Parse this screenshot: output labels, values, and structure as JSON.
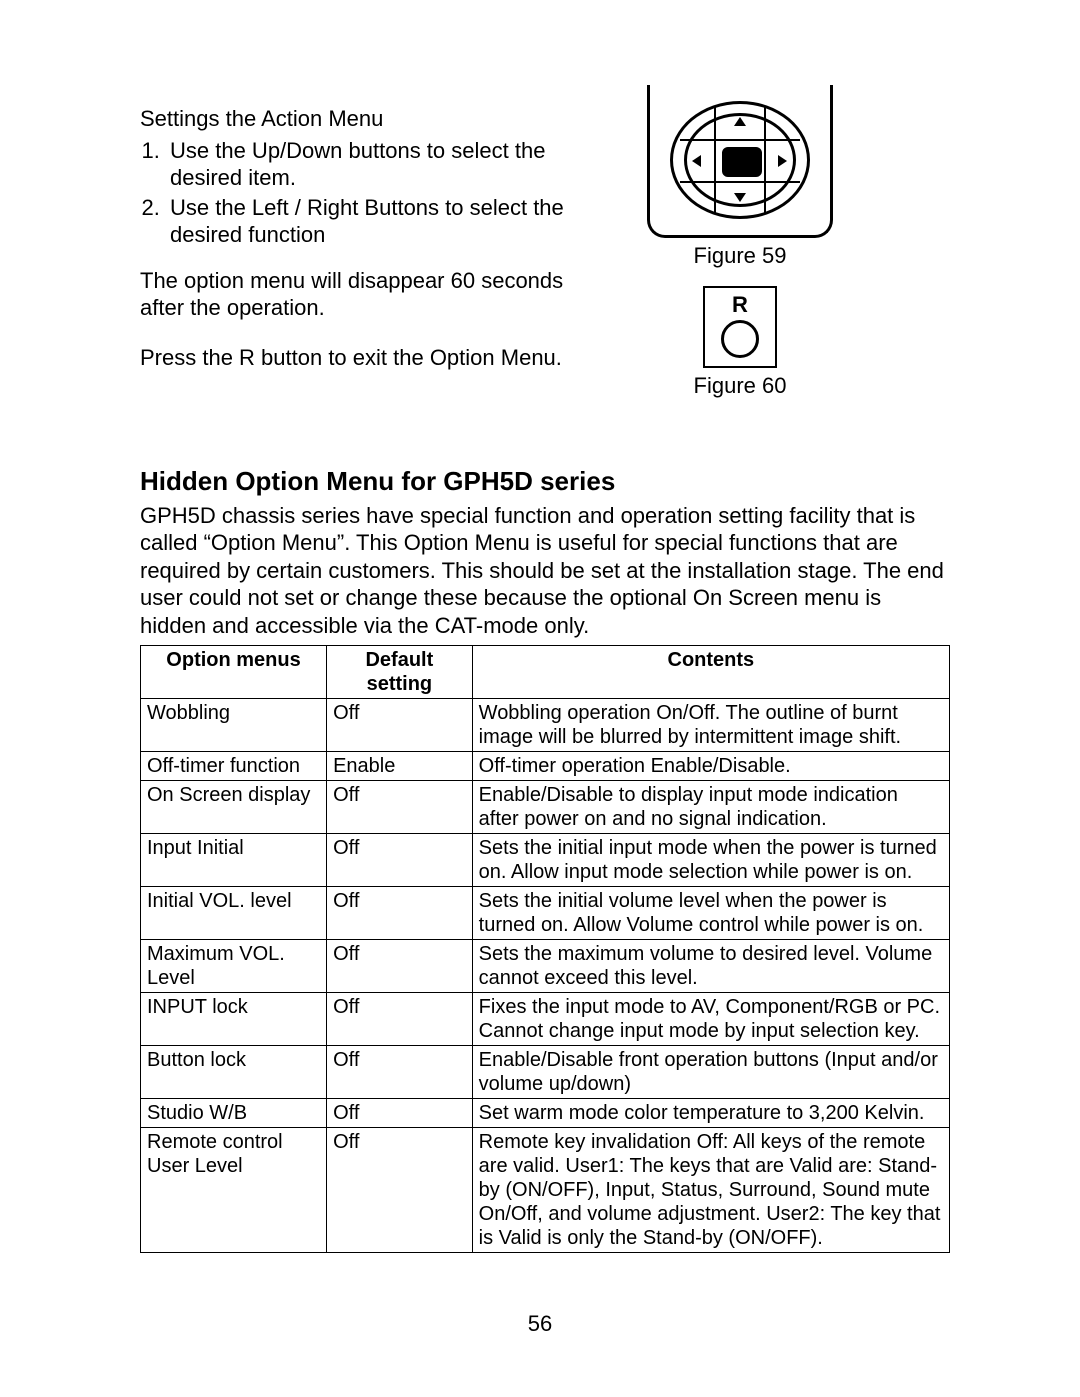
{
  "intro": {
    "heading": "Settings the Action Menu",
    "steps": [
      "Use the Up/Down buttons to select the desired item.",
      "Use the Left / Right Buttons to select the desired function"
    ],
    "note1": "The option menu will disappear 60 seconds after the operation.",
    "note2": "Press the R button to exit the Option Menu."
  },
  "figures": {
    "f59": "Figure 59",
    "f60": "Figure 60",
    "r_label": "R"
  },
  "section": {
    "title": "Hidden Option Menu for GPH5D series",
    "body": "GPH5D chassis series have special function and operation setting facility that is called “Option Menu”. This Option Menu is useful for special functions that are required by certain customers. This should be set at the installation stage. The end user could not set or change these because the optional On Screen menu is hidden and accessible via the CAT-mode only."
  },
  "table": {
    "headers": [
      "Option menus",
      "Default setting",
      "Contents"
    ],
    "rows": [
      {
        "menu": "Wobbling",
        "default": "Off",
        "contents": "Wobbling operation On/Off.\nThe outline of burnt image will be blurred by intermittent image shift."
      },
      {
        "menu": "Off-timer function",
        "default": "Enable",
        "contents": "Off-timer operation Enable/Disable."
      },
      {
        "menu": "On Screen display",
        "default": "Off",
        "contents": "Enable/Disable to display input mode indication after power on and no signal indication."
      },
      {
        "menu": "Input Initial",
        "default": "Off",
        "contents": "Sets the initial input mode when the power is turned on. Allow input mode selection while power is on."
      },
      {
        "menu": "Initial VOL. level",
        "default": "Off",
        "contents": "Sets the initial volume level when the power is turned on. Allow Volume control while power is on."
      },
      {
        "menu": "Maximum VOL. Level",
        "default": "Off",
        "contents": "Sets the maximum volume to desired level. Volume cannot exceed this level."
      },
      {
        "menu": "INPUT lock",
        "default": "Off",
        "contents": "Fixes the input mode to AV, Component/RGB or PC. Cannot change input mode by input selection key."
      },
      {
        "menu": "Button lock",
        "default": "Off",
        "contents": "Enable/Disable front operation buttons (Input and/or volume up/down)"
      },
      {
        "menu": "Studio W/B",
        "default": "Off",
        "contents": "Set warm mode color temperature to 3,200 Kelvin."
      },
      {
        "menu": "Remote control User Level",
        "default": "Off",
        "contents": "Remote key invalidation\nOff: All keys of the remote are valid.\nUser1: The keys that are Valid are: Stand-by (ON/OFF), Input, Status, Surround, Sound mute On/Off, and volume adjustment.\nUser2: The key that is Valid is only the Stand-by (ON/OFF)."
      }
    ]
  },
  "page_number": "56"
}
